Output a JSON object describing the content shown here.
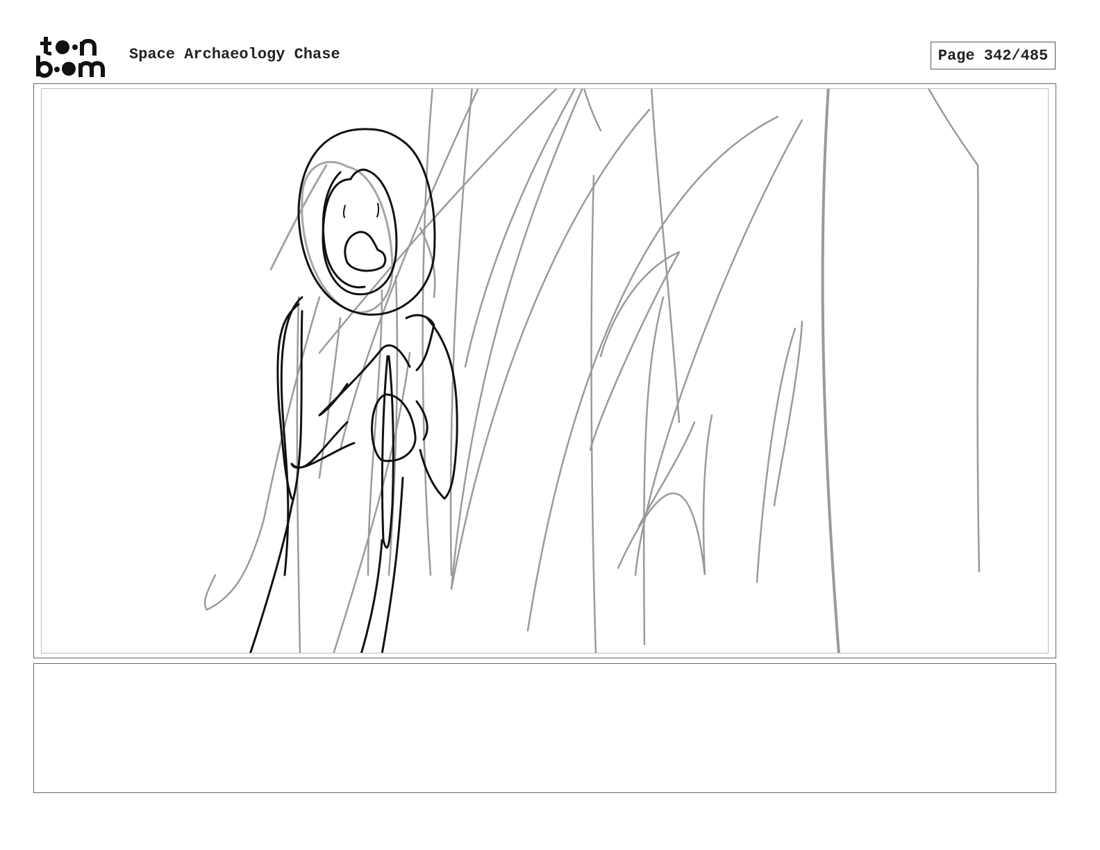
{
  "header": {
    "logo_alt": "toon boom",
    "project_title": "Space Archaeology Chase",
    "page_indicator": "Page 342/485"
  },
  "panel": {
    "sketch_description_icon": "storyboard-sketch",
    "colors": {
      "ink": "#111111",
      "rough": "#9a9a9a",
      "frame": "#666666"
    }
  },
  "notes": {
    "text": ""
  }
}
